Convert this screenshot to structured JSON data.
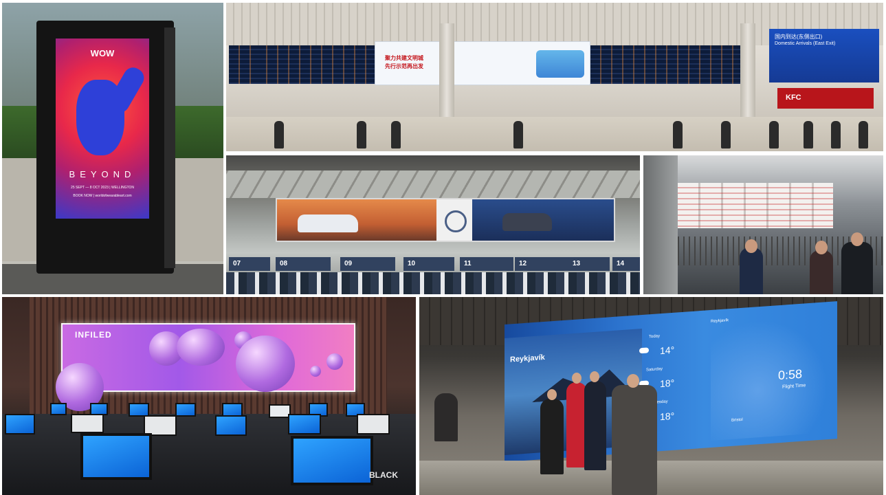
{
  "panels": {
    "poster": {
      "brand": "WOW",
      "headline": "BEYOND",
      "dates": "25 SEPT — 8 OCT 2023 | WELLINGTON",
      "cta": "BOOK NOW | worldofwearableart.com"
    },
    "airport_arrivals": {
      "banner_line1": "聚力共建文明城",
      "banner_line2": "先行示范再出发",
      "arrivals_cn": "国内到达(东侧出口)",
      "arrivals_en": "Domestic Arrivals (East Exit)",
      "restaurant": "KFC"
    },
    "checkin_hall": {
      "counters": [
        "07",
        "08",
        "09",
        "10",
        "11",
        "12",
        "13",
        "14"
      ]
    },
    "control_room": {
      "wall_logo": "INFILED",
      "desk_label": "BLACK"
    },
    "weather_wall": {
      "city": "Reykjavík",
      "days": [
        {
          "day": "Today",
          "temp": "14°"
        },
        {
          "day": "Saturday",
          "temp": "18°"
        },
        {
          "day": "Wednesday",
          "temp": "18°"
        }
      ],
      "flight_time": "0:58",
      "flight_time_label": "Flight Time",
      "from": "Reykjavík",
      "to": "Bristol"
    }
  }
}
